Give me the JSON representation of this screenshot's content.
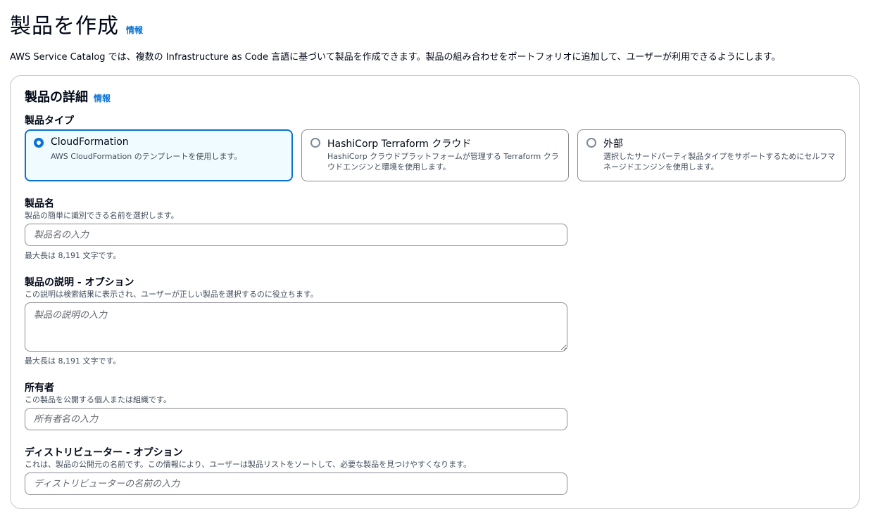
{
  "page": {
    "title": "製品を作成",
    "info": "情報",
    "description": "AWS Service Catalog では、複数の Infrastructure as Code 言語に基づいて製品を作成できます。製品の組み合わせをポートフォリオに追加して、ユーザーが利用できるようにします。"
  },
  "section": {
    "title": "製品の詳細",
    "info": "情報"
  },
  "product_type": {
    "label": "製品タイプ",
    "options": [
      {
        "title": "CloudFormation",
        "description": "AWS CloudFormation のテンプレートを使用します。",
        "selected": true
      },
      {
        "title": "HashiCorp Terraform クラウド",
        "description": "HashiCorp クラウドプラットフォームが管理する Terraform クラウドエンジンと環境を使用します。",
        "selected": false
      },
      {
        "title": "外部",
        "description": "選択したサードパーティ製品タイプをサポートするためにセルフマネージドエンジンを使用します。",
        "selected": false
      }
    ]
  },
  "product_name": {
    "label": "製品名",
    "description": "製品の簡単に識別できる名前を選択します。",
    "placeholder": "製品名の入力",
    "value": "",
    "constraint": "最大長は 8,191 文字です。"
  },
  "product_description": {
    "label": "製品の説明 - オプション",
    "description": "この説明は検索結果に表示され、ユーザーが正しい製品を選択するのに役立ちます。",
    "placeholder": "製品の説明の入力",
    "value": "",
    "constraint": "最大長は 8,191 文字です。"
  },
  "owner": {
    "label": "所有者",
    "description": "この製品を公開する個人または組織です。",
    "placeholder": "所有者名の入力",
    "value": ""
  },
  "distributor": {
    "label": "ディストリビューター - オプション",
    "description": "これは、製品の公開元の名前です。この情報により、ユーザーは製品リストをソートして、必要な製品を見つけやすくなります。",
    "placeholder": "ディストリビューターの名前の入力",
    "value": ""
  },
  "colors": {
    "accent": "#0972d3",
    "selected_bg": "#f0fbff",
    "border": "#8c8c94"
  }
}
